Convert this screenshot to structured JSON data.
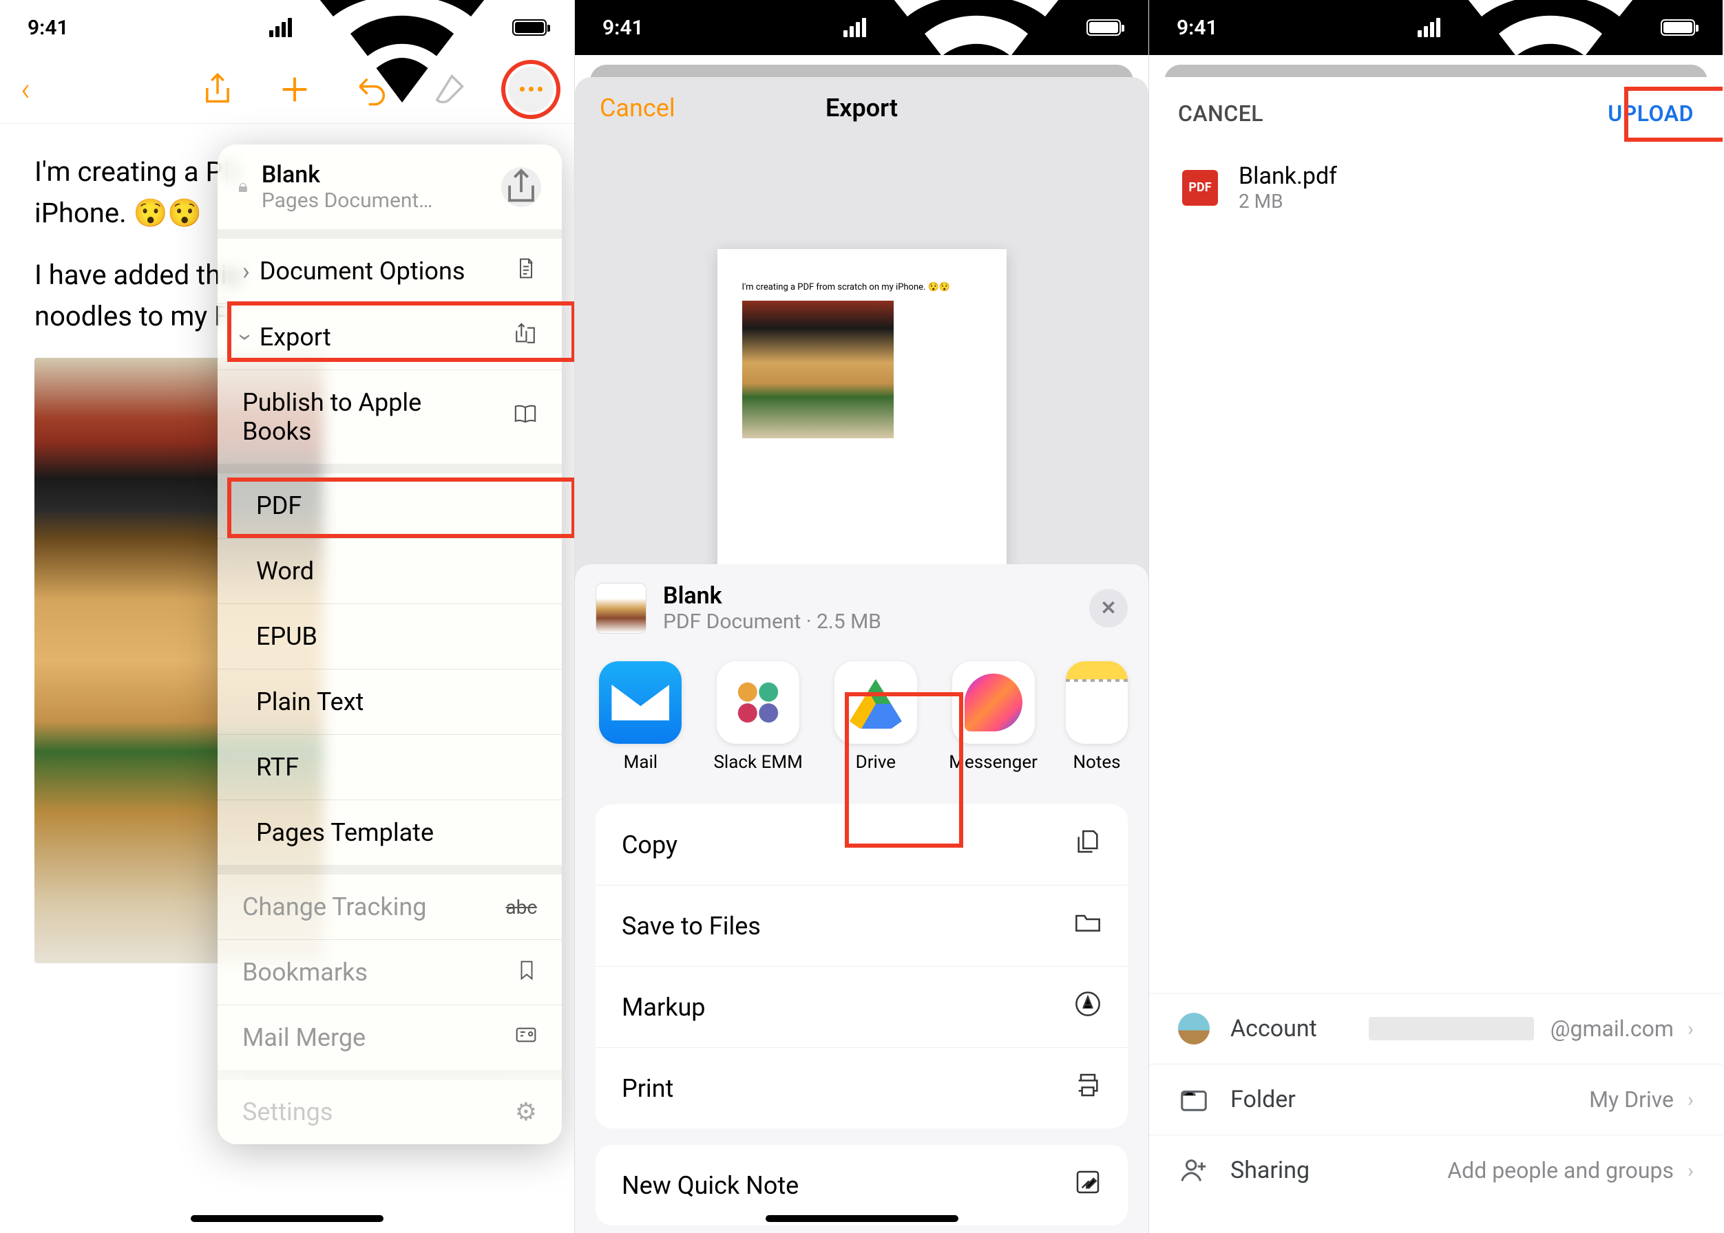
{
  "status": {
    "time": "9:41"
  },
  "screen1": {
    "body_line1": "I'm creating a PDF from scratch on my iPhone. 😯😯",
    "body_line1_trunc": "I'm creating a PD",
    "body_line2": "iPhone. 😯😯",
    "body_line3": "I have added this",
    "body_line4": "noodles to my F",
    "popover": {
      "doc_title": "Blank",
      "doc_sub": "Pages Document…",
      "doc_options": "Document Options",
      "export": "Export",
      "publish": "Publish to Apple Books",
      "pdf": "PDF",
      "word": "Word",
      "epub": "EPUB",
      "plain": "Plain Text",
      "rtf": "RTF",
      "template": "Pages Template",
      "tracking": "Change Tracking",
      "bookmarks": "Bookmarks",
      "mailmerge": "Mail Merge",
      "settings": "Settings"
    }
  },
  "screen2": {
    "cancel": "Cancel",
    "title": "Export",
    "preview_text": "I'm creating a PDF from scratch on my iPhone. 😯😯",
    "share": {
      "title": "Blank",
      "sub": "PDF Document · 2.5 MB",
      "apps": {
        "mail": "Mail",
        "slack": "Slack EMM",
        "drive": "Drive",
        "messenger": "Messenger",
        "notes": "Notes"
      },
      "actions": {
        "copy": "Copy",
        "save": "Save to Files",
        "markup": "Markup",
        "print": "Print",
        "quicknote": "New Quick Note"
      }
    }
  },
  "screen3": {
    "cancel": "CANCEL",
    "upload": "UPLOAD",
    "file": {
      "name": "Blank.pdf",
      "size": "2 MB"
    },
    "rows": {
      "account": "Account",
      "account_val": "@gmail.com",
      "folder": "Folder",
      "folder_val": "My Drive",
      "sharing": "Sharing",
      "sharing_val": "Add people and groups"
    }
  }
}
